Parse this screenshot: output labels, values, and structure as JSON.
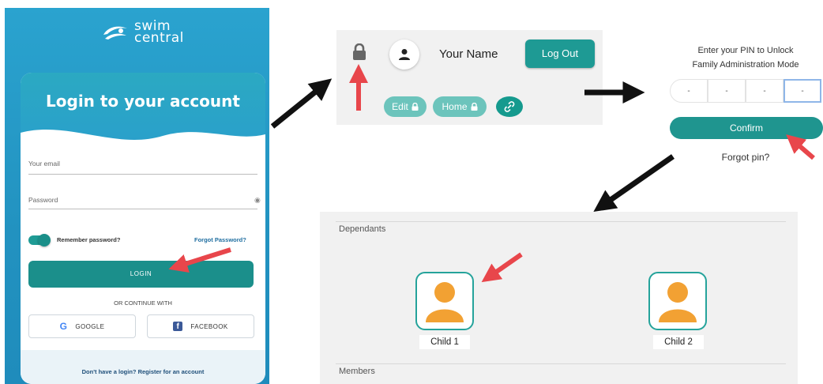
{
  "login": {
    "brand": {
      "line1": "swim",
      "line2": "central"
    },
    "title": "Login to your account",
    "email_label": "Your email",
    "password_label": "Password",
    "remember_label": "Remember password?",
    "forgot_password_label": "Forgot Password?",
    "login_button": "LOGIN",
    "or_continue": "OR CONTINUE WITH",
    "google_button": "GOOGLE",
    "facebook_button": "FACEBOOK",
    "register_text": "Don't have a login? Register for an account"
  },
  "toolbar": {
    "user_name": "Your Name",
    "logout_button": "Log Out",
    "edit_pill": "Edit",
    "home_pill": "Home"
  },
  "pin": {
    "prompt_line1": "Enter your PIN to Unlock",
    "prompt_line2": "Family Administration Mode",
    "digits": [
      "-",
      "-",
      "-",
      "-"
    ],
    "confirm_button": "Confirm",
    "forgot_pin": "Forgot pin?"
  },
  "dependants": {
    "section_title": "Dependants",
    "children": [
      {
        "name": "Child 1"
      },
      {
        "name": "Child 2"
      }
    ],
    "members_title": "Members"
  },
  "colors": {
    "teal": "#1e9a94",
    "light_teal": "#6cc4bc",
    "login_blue": "#2a9ecd",
    "avatar_orange": "#f2a133",
    "arrow_black": "#111111",
    "arrow_red": "#e8464b"
  }
}
